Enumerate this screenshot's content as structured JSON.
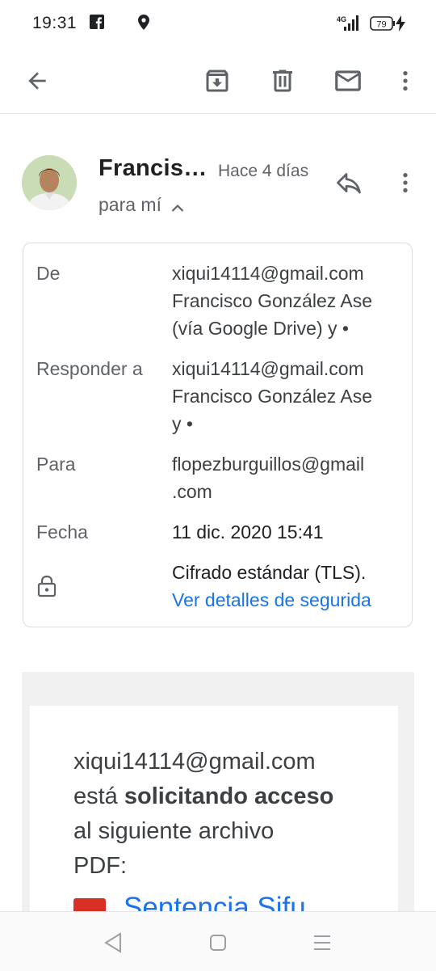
{
  "status_bar": {
    "time": "19:31",
    "network": "4G",
    "battery": "79",
    "icons": [
      "facebook-icon",
      "location-icon",
      "signal-icon",
      "battery-icon",
      "charging-icon"
    ]
  },
  "toolbar": {
    "actions": [
      "back-arrow-icon",
      "archive-icon",
      "delete-icon",
      "mark-unread-icon",
      "more-vert-icon"
    ]
  },
  "message": {
    "sender_name": "Francis…",
    "date": "Hace 4 días",
    "recipient_summary": "para mí",
    "details": {
      "from_label": "De",
      "from_value_1": "xiqui14114@gmail.com",
      "from_value_2": "Francisco González Ase",
      "from_value_3": "(vía Google Drive) y •",
      "reply_label": "Responder a",
      "reply_value_1": "xiqui14114@gmail.com",
      "reply_value_2": "Francisco González Ase",
      "reply_value_3": "y •",
      "to_label": "Para",
      "to_value_1": "flopezburguillos@gmail",
      "to_value_2": ".com",
      "date_label": "Fecha",
      "date_value": "11 dic. 2020 15:41",
      "security_value": "Cifrado estándar (TLS).",
      "security_link": "Ver detalles de segurida"
    },
    "body": {
      "line1": "xiqui14114@gmail.com",
      "line2_prefix": "está ",
      "line2_bold": "solicitando acceso",
      "line3": "al siguiente archivo",
      "line4": "PDF:",
      "file_name": "Sentencia Sifu"
    }
  },
  "colors": {
    "link": "#1a73e8",
    "pdf_icon": "#d93025",
    "secondary_text": "#5f6368"
  }
}
